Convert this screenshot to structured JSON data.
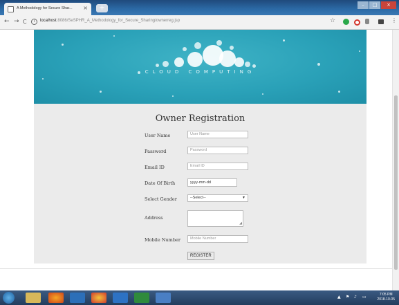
{
  "browser": {
    "tab_title": "A Methodology for Secure Shar...",
    "tab_close": "×",
    "new_tab": "+",
    "back": "←",
    "forward": "→",
    "reload": "C",
    "url_host": "localhost",
    "url_path": ":8086/SeSPHR_A_Methodology_for_Secure_Sharing/ownerreg.jsp",
    "info": "i",
    "star": "☆",
    "menu": "⋮",
    "win_min": "–",
    "win_max": "□",
    "win_close": "×"
  },
  "banner": {
    "text": "CLOUD COMPUTING",
    "accent": "#2aa1b8"
  },
  "form": {
    "title": "Owner Registration",
    "fields": {
      "username": {
        "label": "User Name",
        "placeholder": "User Name"
      },
      "password": {
        "label": "Password",
        "placeholder": "Password"
      },
      "email": {
        "label": "Email ID",
        "placeholder": "Email ID"
      },
      "dob": {
        "label": "Date Of Birth",
        "value": "yyyy-mm-dd"
      },
      "gender": {
        "label": "Select Gender",
        "value": "--Select--"
      },
      "address": {
        "label": "Address"
      },
      "mobile": {
        "label": "Mobile Number",
        "placeholder": "Mobile Number"
      }
    },
    "submit_label": "REGISTER"
  },
  "taskbar": {
    "time": "7:05 PM",
    "date": "2018-10-05"
  }
}
